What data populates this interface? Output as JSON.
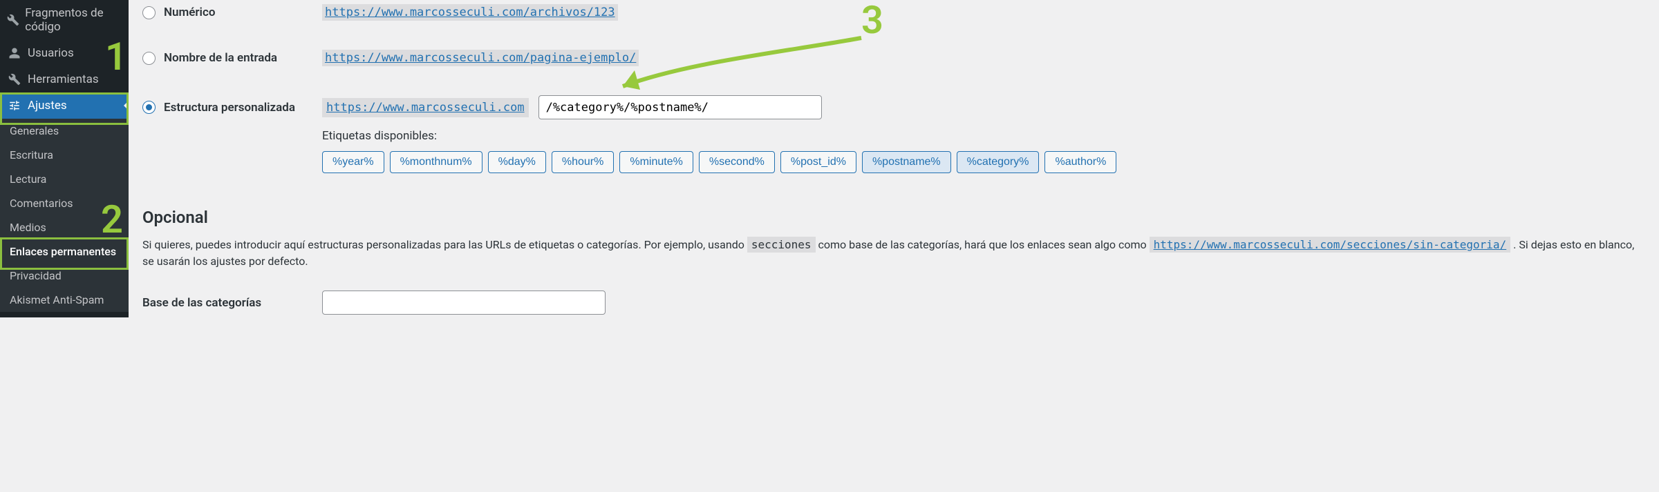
{
  "sidebar": {
    "items": [
      {
        "label": "Fragmentos de código",
        "icon": "plug"
      },
      {
        "label": "Usuarios",
        "icon": "user"
      },
      {
        "label": "Herramientas",
        "icon": "wrench"
      },
      {
        "label": "Ajustes",
        "icon": "sliders",
        "active": true
      }
    ],
    "submenu": [
      {
        "label": "Generales"
      },
      {
        "label": "Escritura"
      },
      {
        "label": "Lectura"
      },
      {
        "label": "Comentarios"
      },
      {
        "label": "Medios"
      },
      {
        "label": "Enlaces permanentes",
        "current": true
      },
      {
        "label": "Privacidad"
      },
      {
        "label": "Akismet Anti-Spam"
      }
    ]
  },
  "permalink": {
    "options": [
      {
        "label": "Numérico",
        "example": "https://www.marcosseculi.com/archivos/123",
        "checked": false
      },
      {
        "label": "Nombre de la entrada",
        "example": "https://www.marcosseculi.com/pagina-ejemplo/",
        "checked": false
      }
    ],
    "custom": {
      "label": "Estructura personalizada",
      "base": "https://www.marcosseculi.com",
      "value": "/%category%/%postname%/",
      "checked": true
    },
    "tags_label": "Etiquetas disponibles:",
    "tags": [
      {
        "label": "%year%",
        "active": false
      },
      {
        "label": "%monthnum%",
        "active": false
      },
      {
        "label": "%day%",
        "active": false
      },
      {
        "label": "%hour%",
        "active": false
      },
      {
        "label": "%minute%",
        "active": false
      },
      {
        "label": "%second%",
        "active": false
      },
      {
        "label": "%post_id%",
        "active": false
      },
      {
        "label": "%postname%",
        "active": true
      },
      {
        "label": "%category%",
        "active": true
      },
      {
        "label": "%author%",
        "active": false
      }
    ]
  },
  "optional": {
    "heading": "Opcional",
    "p_part1": "Si quieres, puedes introducir aquí estructuras personalizadas para las URLs de etiquetas o categorías. Por ejemplo, usando ",
    "p_code": "secciones",
    "p_part2": " como base de las categorías, hará que los enlaces sean algo como ",
    "p_link": "https://www.marcosseculi.com/secciones/sin-categoria/",
    "p_part3": " . Si dejas esto en blanco, se usarán los ajustes por defecto.",
    "cat_base_label": "Base de las categorías",
    "cat_base_value": ""
  },
  "annotations": {
    "n1": "1",
    "n2": "2",
    "n3": "3"
  }
}
